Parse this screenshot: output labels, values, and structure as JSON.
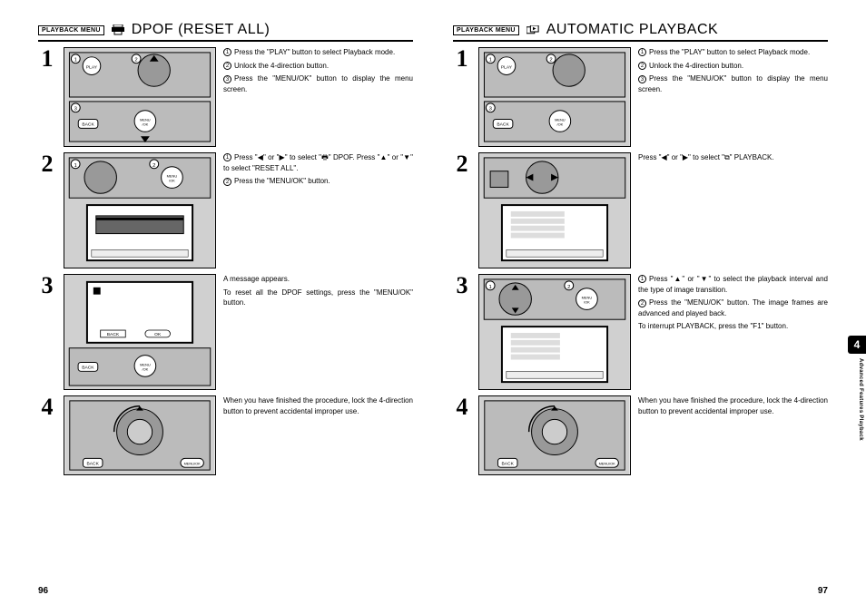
{
  "left": {
    "menuBadge": "PLAYBACK MENU",
    "title": "DPOF (RESET ALL)",
    "pageNum": "96",
    "steps": [
      {
        "num": "1",
        "lines": [
          {
            "n": "1",
            "t": "Press the \"PLAY\" button to select Playback mode."
          },
          {
            "n": "2",
            "t": "Unlock the 4-direction button."
          },
          {
            "n": "3",
            "t": "Press the \"MENU/OK\" button to display the menu screen."
          }
        ]
      },
      {
        "num": "2",
        "lines": [
          {
            "n": "1",
            "t": "Press \"◀\" or \"▶\" to select \"🖶\" DPOF. Press \"▲\" or \"▼\" to select \"RESET ALL\"."
          },
          {
            "n": "2",
            "t": "Press the \"MENU/OK\" button."
          }
        ]
      },
      {
        "num": "3",
        "lines": [
          {
            "n": "",
            "t": "A message appears."
          },
          {
            "n": "",
            "t": "To reset all the DPOF settings, press the \"MENU/OK\" button."
          }
        ]
      },
      {
        "num": "4",
        "lines": [
          {
            "n": "",
            "t": "When you have finished the procedure, lock the 4-direction button to prevent accidental improper use."
          }
        ]
      }
    ]
  },
  "right": {
    "menuBadge": "PLAYBACK MENU",
    "title": "AUTOMATIC PLAYBACK",
    "pageNum": "97",
    "sideTab": "4",
    "sideText": "Advanced Features Playback",
    "steps": [
      {
        "num": "1",
        "lines": [
          {
            "n": "1",
            "t": "Press the \"PLAY\" button to select Playback mode."
          },
          {
            "n": "2",
            "t": "Unlock the 4-direction button."
          },
          {
            "n": "3",
            "t": "Press the \"MENU/OK\" button to display the menu screen."
          }
        ]
      },
      {
        "num": "2",
        "lines": [
          {
            "n": "",
            "t": "Press \"◀\" or \"▶\" to select \"⧉\" PLAYBACK."
          }
        ]
      },
      {
        "num": "3",
        "lines": [
          {
            "n": "1",
            "t": "Press \"▲\" or \"▼\" to select the playback interval and the type of image transition."
          },
          {
            "n": "2",
            "t": "Press the \"MENU/OK\" button. The image frames are advanced and played back."
          },
          {
            "n": "",
            "t": "To interrupt PLAYBACK, press the \"F1\" button."
          }
        ]
      },
      {
        "num": "4",
        "lines": [
          {
            "n": "",
            "t": "When you have finished the procedure, lock the 4-direction button to prevent accidental improper use."
          }
        ]
      }
    ]
  }
}
